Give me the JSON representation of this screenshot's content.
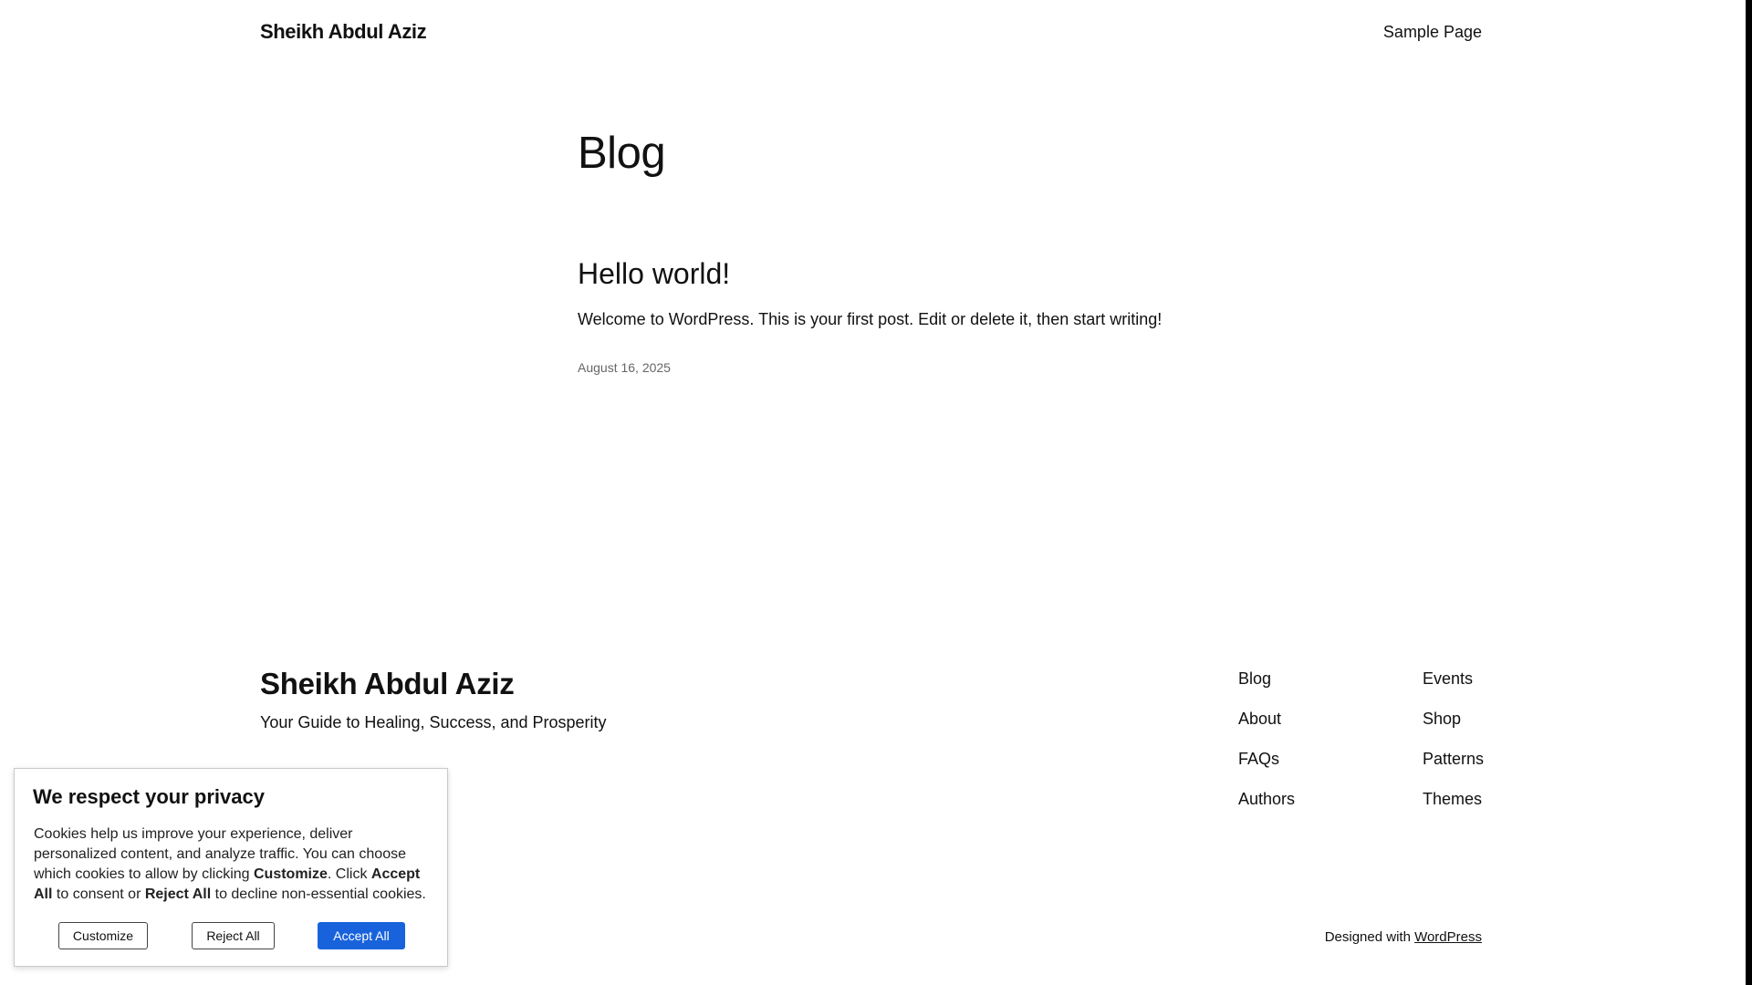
{
  "header": {
    "site_title": "Sheikh Abdul Aziz",
    "nav": [
      "Sample Page"
    ]
  },
  "main": {
    "heading": "Blog",
    "posts": [
      {
        "title": "Hello world!",
        "excerpt": "Welcome to WordPress. This is your first post. Edit or delete it, then start writing!",
        "date": "August 16, 2025"
      }
    ]
  },
  "footer": {
    "site_title": "Sheikh Abdul Aziz",
    "tagline": "Your Guide to Healing, Success, and Prosperity",
    "nav_col1": [
      "Blog",
      "About",
      "FAQs",
      "Authors"
    ],
    "nav_col2": [
      "Events",
      "Shop",
      "Patterns",
      "Themes"
    ],
    "designed_prefix": "Designed with",
    "designed_link": "WordPress"
  },
  "cookie_banner": {
    "title": "We respect your privacy",
    "text_parts": [
      "Cookies help us improve your experience, deliver personalized content, and analyze traffic. You can choose which cookies to allow by clicking ",
      "Customize",
      ". Click ",
      "Accept All",
      " to consent or ",
      "Reject All",
      " to decline non-essential cookies."
    ],
    "buttons": {
      "customize": "Customize",
      "reject": "Reject All",
      "accept": "Accept All"
    },
    "accent_color": "#1863dc"
  }
}
